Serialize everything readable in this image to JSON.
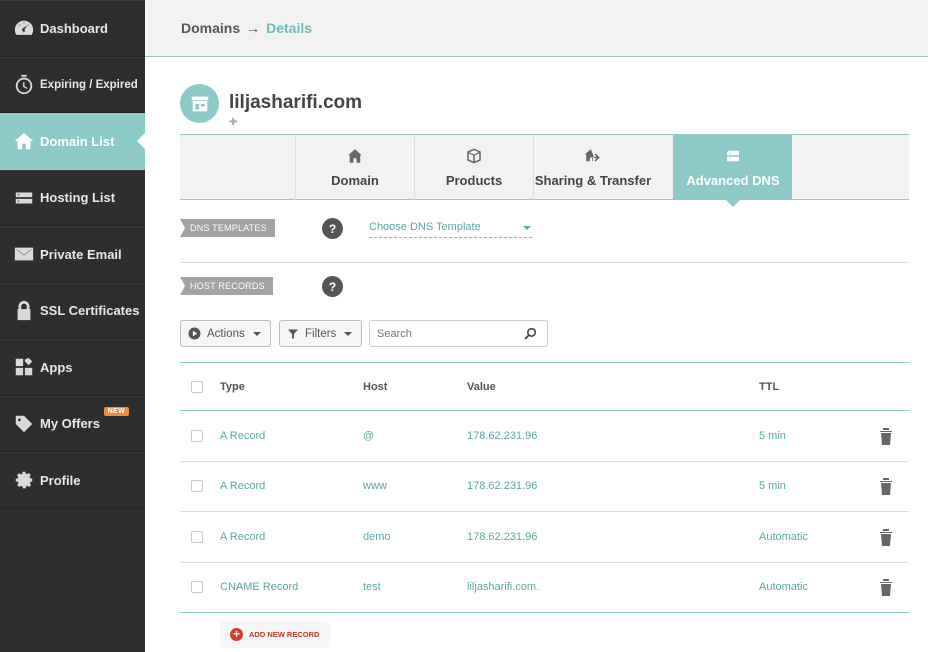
{
  "sidebar": {
    "items": [
      {
        "label": "Dashboard",
        "icon": "speedometer-icon"
      },
      {
        "label": "Expiring / Expired",
        "icon": "timer-icon"
      },
      {
        "label": "Domain List",
        "icon": "home-icon",
        "active": true
      },
      {
        "label": "Hosting List",
        "icon": "server-icon"
      },
      {
        "label": "Private Email",
        "icon": "envelope-icon"
      },
      {
        "label": "SSL Certificates",
        "icon": "lock-icon"
      },
      {
        "label": "Apps",
        "icon": "apps-icon"
      },
      {
        "label": "My Offers",
        "icon": "tag-icon",
        "badge": "NEW"
      },
      {
        "label": "Profile",
        "icon": "gear-icon"
      }
    ]
  },
  "breadcrumb": {
    "root": "Domains",
    "separator": "→",
    "current": "Details"
  },
  "domain": {
    "name": "liljasharifi.com",
    "tag_icon": "✚"
  },
  "tabs": [
    {
      "label": "Domain",
      "icon": "home-icon"
    },
    {
      "label": "Products",
      "icon": "box-icon"
    },
    {
      "label": "Sharing & Transfer",
      "icon": "transfer-icon"
    },
    {
      "label": "Advanced DNS",
      "icon": "dns-icon",
      "active": true
    }
  ],
  "dns_templates": {
    "label": "DNS TEMPLATES",
    "help": "?",
    "select_value": "Choose DNS Template"
  },
  "host_records": {
    "label": "HOST RECORDS",
    "help": "?"
  },
  "toolbar": {
    "actions_label": "Actions",
    "filters_label": "Filters",
    "search_placeholder": "Search"
  },
  "table": {
    "headers": {
      "type": "Type",
      "host": "Host",
      "value": "Value",
      "ttl": "TTL"
    },
    "rows": [
      {
        "type": "A Record",
        "host": "@",
        "value": "178.62.231.96",
        "ttl": "5 min"
      },
      {
        "type": "A Record",
        "host": "www",
        "value": "178.62.231.96",
        "ttl": "5 min"
      },
      {
        "type": "A Record",
        "host": "demo",
        "value": "178.62.231.96",
        "ttl": "Automatic"
      },
      {
        "type": "CNAME Record",
        "host": "test",
        "value": "liljasharifi.com.",
        "ttl": "Automatic"
      }
    ]
  },
  "add_new": {
    "label": "ADD NEW RECORD",
    "icon": "+"
  },
  "colors": {
    "accent": "#8ccbc7",
    "sidebar": "#2e2e2e",
    "link": "#5aa7a1",
    "badge": "#f08a3c",
    "add_red": "#d9382f"
  }
}
